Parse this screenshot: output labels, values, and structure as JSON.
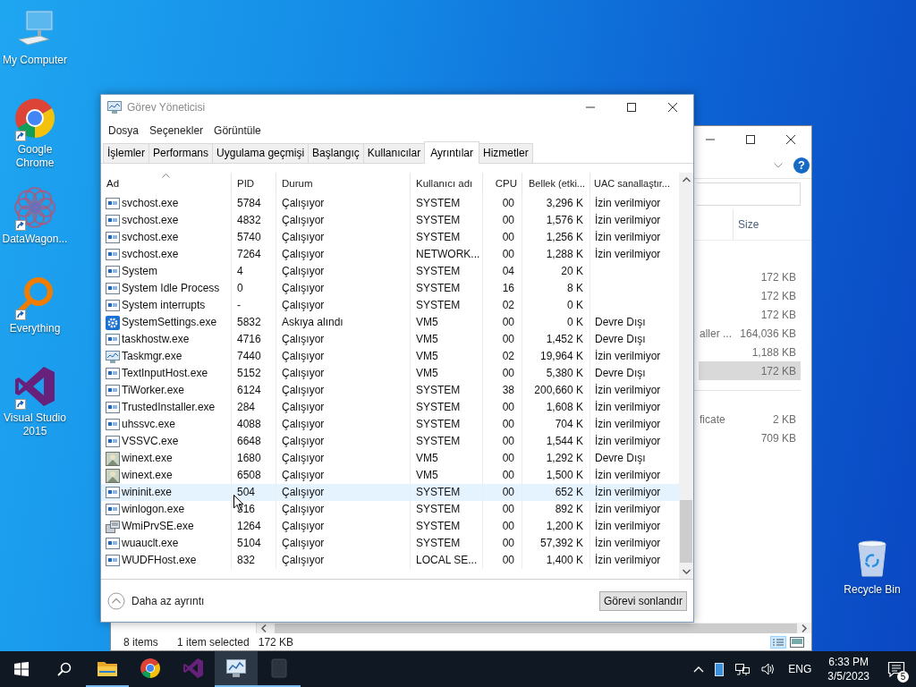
{
  "desktop_icons": [
    {
      "label": "My Computer",
      "kind": "computer",
      "shortcut": false
    },
    {
      "label": "Google Chrome",
      "kind": "chrome",
      "shortcut": true
    },
    {
      "label": "DataWagon...",
      "kind": "pattern",
      "shortcut": true
    },
    {
      "label": "Everything",
      "kind": "magnifier",
      "shortcut": true
    },
    {
      "label": "Visual Studio 2015",
      "kind": "studio",
      "shortcut": true
    }
  ],
  "recycle_bin": {
    "label": "Recycle Bin"
  },
  "explorer": {
    "help": "?",
    "size_header": "Size",
    "groups": [
      {
        "rows": [
          {
            "size": "172 KB",
            "selected": false
          },
          {
            "size": "172 KB",
            "selected": false
          },
          {
            "size": "172 KB",
            "selected": false
          },
          {
            "name": "aller ...",
            "size": "164,036 KB",
            "selected": false
          },
          {
            "size": "1,188 KB",
            "selected": false
          },
          {
            "size": "172 KB",
            "selected": true
          }
        ]
      },
      {
        "rows": [
          {
            "name": "ficate",
            "size": "2 KB",
            "selected": false
          },
          {
            "size": "709 KB",
            "selected": false
          }
        ]
      }
    ],
    "status": {
      "items": "8 items",
      "selection": "1 item selected",
      "selection_size": "172 KB"
    }
  },
  "task_manager": {
    "title": "Görev Yöneticisi",
    "menu": [
      "Dosya",
      "Seçenekler",
      "Görüntüle"
    ],
    "tabs": [
      {
        "label": "İşlemler",
        "selected": false
      },
      {
        "label": "Performans",
        "selected": false
      },
      {
        "label": "Uygulama geçmişi",
        "selected": false
      },
      {
        "label": "Başlangıç",
        "selected": false
      },
      {
        "label": "Kullanıcılar",
        "selected": false
      },
      {
        "label": "Ayrıntılar",
        "selected": true
      },
      {
        "label": "Hizmetler",
        "selected": false
      }
    ],
    "columns": [
      {
        "label": "Ad",
        "sorted": true
      },
      {
        "label": "PID",
        "sorted": false
      },
      {
        "label": "Durum",
        "sorted": false
      },
      {
        "label": "Kullanıcı adı",
        "sorted": false
      },
      {
        "label": "CPU",
        "sorted": false
      },
      {
        "label": "Bellek (etki...",
        "sorted": false
      },
      {
        "label": "UAC sanallaştır...",
        "sorted": false
      }
    ],
    "rows": [
      {
        "kind": "service",
        "name": "svchost.exe",
        "pid": "5784",
        "status": "Çalışıyor",
        "user": "SYSTEM",
        "cpu": "00",
        "memory": "3,296 K",
        "uac": "İzin verilmiyor",
        "hovered": false
      },
      {
        "kind": "service",
        "name": "svchost.exe",
        "pid": "4832",
        "status": "Çalışıyor",
        "user": "SYSTEM",
        "cpu": "00",
        "memory": "1,576 K",
        "uac": "İzin verilmiyor",
        "hovered": false
      },
      {
        "kind": "service",
        "name": "svchost.exe",
        "pid": "5740",
        "status": "Çalışıyor",
        "user": "SYSTEM",
        "cpu": "00",
        "memory": "1,256 K",
        "uac": "İzin verilmiyor",
        "hovered": false
      },
      {
        "kind": "service",
        "name": "svchost.exe",
        "pid": "7264",
        "status": "Çalışıyor",
        "user": "NETWORK...",
        "cpu": "00",
        "memory": "1,288 K",
        "uac": "İzin verilmiyor",
        "hovered": false
      },
      {
        "kind": "service",
        "name": "System",
        "pid": "4",
        "status": "Çalışıyor",
        "user": "SYSTEM",
        "cpu": "04",
        "memory": "20 K",
        "hovered": false
      },
      {
        "kind": "service",
        "name": "System Idle Process",
        "pid": "0",
        "status": "Çalışıyor",
        "user": "SYSTEM",
        "cpu": "16",
        "memory": "8 K",
        "hovered": false
      },
      {
        "kind": "service",
        "name": "System interrupts",
        "pid": "-",
        "status": "Çalışıyor",
        "user": "SYSTEM",
        "cpu": "02",
        "memory": "0 K",
        "hovered": false
      },
      {
        "kind": "settings",
        "name": "SystemSettings.exe",
        "pid": "5832",
        "status": "Askıya alındı",
        "user": "VM5",
        "cpu": "00",
        "memory": "0 K",
        "uac": "Devre Dışı",
        "hovered": false
      },
      {
        "kind": "service",
        "name": "taskhostw.exe",
        "pid": "4716",
        "status": "Çalışıyor",
        "user": "VM5",
        "cpu": "00",
        "memory": "1,452 K",
        "uac": "Devre Dışı",
        "hovered": false
      },
      {
        "kind": "monitor",
        "name": "Taskmgr.exe",
        "pid": "7440",
        "status": "Çalışıyor",
        "user": "VM5",
        "cpu": "02",
        "memory": "19,964 K",
        "uac": "İzin verilmiyor",
        "hovered": false
      },
      {
        "kind": "service",
        "name": "TextInputHost.exe",
        "pid": "5152",
        "status": "Çalışıyor",
        "user": "VM5",
        "cpu": "00",
        "memory": "5,380 K",
        "uac": "Devre Dışı",
        "hovered": false
      },
      {
        "kind": "service",
        "name": "TiWorker.exe",
        "pid": "6124",
        "status": "Çalışıyor",
        "user": "SYSTEM",
        "cpu": "38",
        "memory": "200,660 K",
        "uac": "İzin verilmiyor",
        "hovered": false
      },
      {
        "kind": "service",
        "name": "TrustedInstaller.exe",
        "pid": "284",
        "status": "Çalışıyor",
        "user": "SYSTEM",
        "cpu": "00",
        "memory": "1,608 K",
        "uac": "İzin verilmiyor",
        "hovered": false
      },
      {
        "kind": "service",
        "name": "uhssvc.exe",
        "pid": "4088",
        "status": "Çalışıyor",
        "user": "SYSTEM",
        "cpu": "00",
        "memory": "704 K",
        "uac": "İzin verilmiyor",
        "hovered": false
      },
      {
        "kind": "service",
        "name": "VSSVC.exe",
        "pid": "6648",
        "status": "Çalışıyor",
        "user": "SYSTEM",
        "cpu": "00",
        "memory": "1,544 K",
        "uac": "İzin verilmiyor",
        "hovered": false
      },
      {
        "kind": "photo",
        "name": "winext.exe",
        "pid": "1680",
        "status": "Çalışıyor",
        "user": "VM5",
        "cpu": "00",
        "memory": "1,292 K",
        "uac": "Devre Dışı",
        "hovered": false
      },
      {
        "kind": "photo",
        "name": "winext.exe",
        "pid": "6508",
        "status": "Çalışıyor",
        "user": "VM5",
        "cpu": "00",
        "memory": "1,500 K",
        "uac": "İzin verilmiyor",
        "hovered": false
      },
      {
        "kind": "service",
        "name": "wininit.exe",
        "pid": "504",
        "status": "Çalışıyor",
        "user": "SYSTEM",
        "cpu": "00",
        "memory": "652 K",
        "uac": "İzin verilmiyor",
        "hovered": true
      },
      {
        "kind": "service",
        "name": "winlogon.exe",
        "pid": "316",
        "status": "Çalışıyor",
        "user": "SYSTEM",
        "cpu": "00",
        "memory": "892 K",
        "uac": "İzin verilmiyor",
        "hovered": false
      },
      {
        "kind": "tools",
        "name": "WmiPrvSE.exe",
        "pid": "1264",
        "status": "Çalışıyor",
        "user": "SYSTEM",
        "cpu": "00",
        "memory": "1,200 K",
        "uac": "İzin verilmiyor",
        "hovered": false
      },
      {
        "kind": "service",
        "name": "wuauclt.exe",
        "pid": "5104",
        "status": "Çalışıyor",
        "user": "SYSTEM",
        "cpu": "00",
        "memory": "57,392 K",
        "uac": "İzin verilmiyor",
        "hovered": false
      },
      {
        "kind": "service",
        "name": "WUDFHost.exe",
        "pid": "832",
        "status": "Çalışıyor",
        "user": "LOCAL SE...",
        "cpu": "00",
        "memory": "1,400 K",
        "uac": "İzin verilmiyor",
        "hovered": false
      }
    ],
    "fewer_details": "Daha az ayrıntı",
    "end_task": "Görevi sonlandır"
  },
  "taskbar": {
    "items": [
      {
        "kind": "folder",
        "running": true,
        "active": false
      },
      {
        "kind": "chrome",
        "running": false,
        "active": false
      },
      {
        "kind": "studio",
        "running": false,
        "active": false
      },
      {
        "kind": "monitor",
        "running": true,
        "active": true
      },
      {
        "kind": "blank",
        "running": true,
        "active": false
      }
    ],
    "language": "ENG",
    "time": "6:33 PM",
    "date": "3/5/2023",
    "notifications": "5"
  }
}
